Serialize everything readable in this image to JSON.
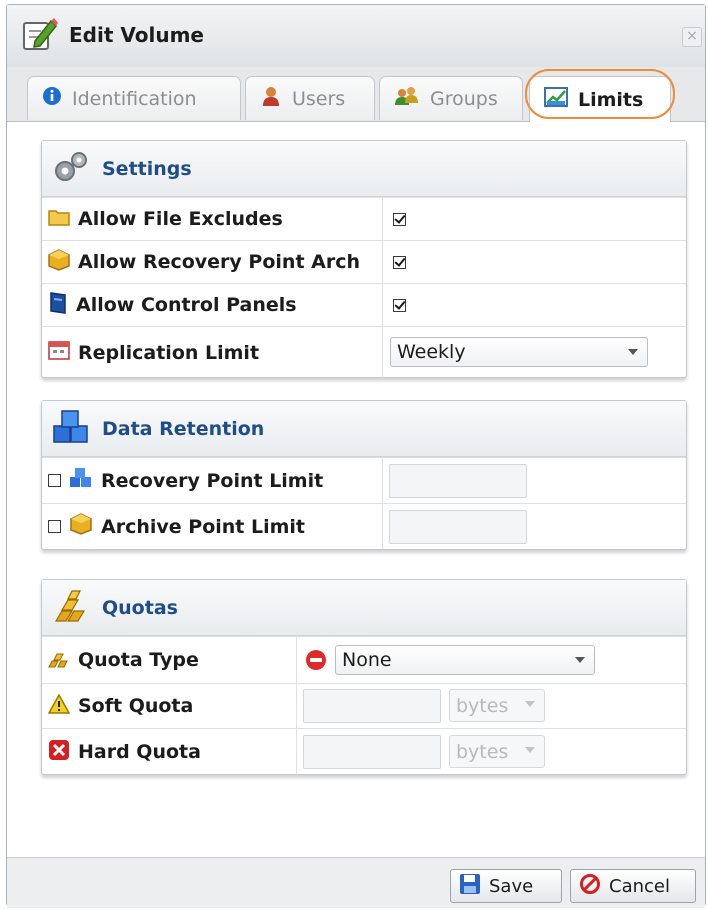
{
  "dialog": {
    "title": "Edit Volume",
    "close_glyph": "×"
  },
  "tabs": [
    {
      "label": "Identification",
      "active": false
    },
    {
      "label": "Users",
      "active": false
    },
    {
      "label": "Groups",
      "active": false
    },
    {
      "label": "Limits",
      "active": true
    }
  ],
  "settings": {
    "title": "Settings",
    "rows": [
      {
        "label": "Allow File Excludes",
        "checked": true
      },
      {
        "label": "Allow Recovery Point Arch",
        "checked": true
      },
      {
        "label": "Allow Control Panels",
        "checked": true
      },
      {
        "label": "Replication Limit",
        "value": "Weekly"
      }
    ]
  },
  "retention": {
    "title": "Data Retention",
    "rows": [
      {
        "label": "Recovery Point Limit",
        "checked": false,
        "value": ""
      },
      {
        "label": "Archive Point Limit",
        "checked": false,
        "value": ""
      }
    ]
  },
  "quotas": {
    "title": "Quotas",
    "rows": [
      {
        "label": "Quota Type",
        "value": "None"
      },
      {
        "label": "Soft Quota",
        "value": "",
        "unit": "bytes"
      },
      {
        "label": "Hard Quota",
        "value": "",
        "unit": "bytes"
      }
    ]
  },
  "footer": {
    "save_label": "Save",
    "cancel_label": "Cancel"
  },
  "colors": {
    "accent": "#1f4d8a",
    "tab_highlight": "#ef8b3a"
  }
}
